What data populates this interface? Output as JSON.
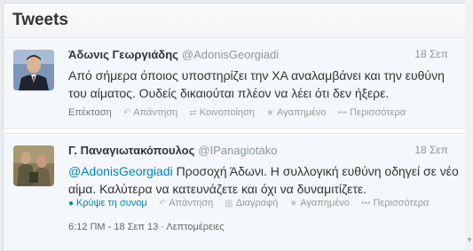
{
  "header": {
    "title": "Tweets"
  },
  "tweets": [
    {
      "name": "Άδωνις Γεωργιάδης",
      "handle": "@AdonisGeorgiadi",
      "time": "18 Σεπ",
      "text": "Από σήμερα όποιος υποστηρίζει την ΧΑ αναλαμβάνει και την ευθύνη του αίματος. Ουδείς δικαιούται πλέον να λέει ότι δεν ήξερε.",
      "actions": {
        "expand": "Επέκταση",
        "reply": "Απάντηση",
        "retweet": "Κοινοποίηση",
        "favorite": "Αγαπημένο",
        "more": "Περισσότερα"
      }
    },
    {
      "name": "Γ. Παναγιωτακόπουλος",
      "handle": "@IPanagiotako",
      "time": "18 Σεπ",
      "mention": "@AdonisGeorgiadi",
      "text": " Προσοχή Άδωνι. Η συλλογική ευθύνη οδηγεί σε νέο αίμα. Καλύτερα να κατευνάζετε και όχι να δυναμιτίζετε.",
      "actions": {
        "collapse": "Κρύψε τη συνομ",
        "reply": "Απάντηση",
        "delete": "Διαγραφή",
        "favorite": "Αγαπημένο",
        "more": "Περισσότερα"
      },
      "meta": "6:12 ΠΜ - 18 Σεπ 13 · Λεπτομέρειες"
    }
  ]
}
